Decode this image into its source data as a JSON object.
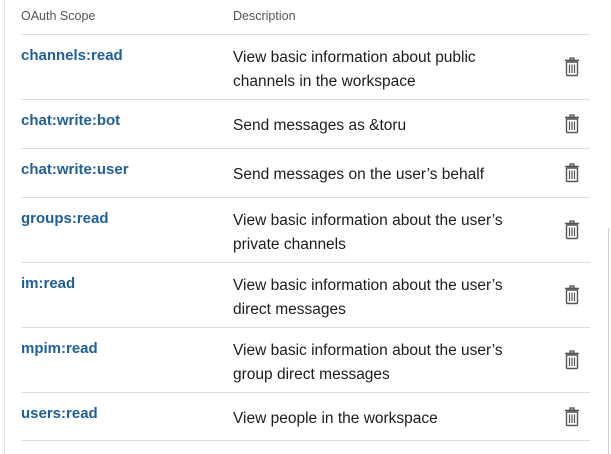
{
  "table": {
    "headers": {
      "scope": "OAuth Scope",
      "description": "Description"
    },
    "rows": [
      {
        "scope": "channels:read",
        "description": "View basic information about public channels in the workspace"
      },
      {
        "scope": "chat:write:bot",
        "description": "Send messages as &toru"
      },
      {
        "scope": "chat:write:user",
        "description": "Send messages on the user’s behalf"
      },
      {
        "scope": "groups:read",
        "description": "View basic information about the user’s private channels"
      },
      {
        "scope": "im:read",
        "description": "View basic information about the user’s direct messages"
      },
      {
        "scope": "mpim:read",
        "description": "View basic information about the user’s group direct messages"
      },
      {
        "scope": "users:read",
        "description": "View people in the workspace"
      }
    ],
    "row_action_icon": "trash-icon"
  },
  "colors": {
    "scope_link": "#1f5f9a",
    "text": "#1d1c1d",
    "header_text": "#555555",
    "divider": "#dddddd"
  }
}
